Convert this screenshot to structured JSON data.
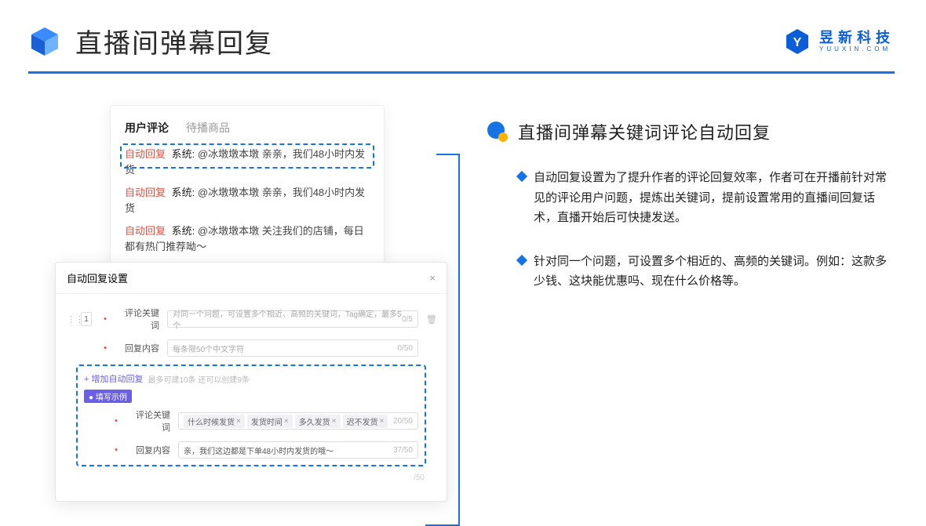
{
  "header": {
    "title": "直播间弹幕回复",
    "brand_cn": "昱新科技",
    "brand_en": "YUUXIN.COM"
  },
  "comments_card": {
    "tab_active": "用户评论",
    "tab_inactive": "待播商品",
    "auto_reply_label": "自动回复",
    "system_label": "系统:",
    "c1": "@冰墩墩本墩 亲亲，我们48小时内发货",
    "c2": "@冰墩墩本墩 亲亲，我们48小时内发货",
    "c3": "@冰墩墩本墩 关注我们的店铺，每日都有热门推荐呦～"
  },
  "settings": {
    "title": "自动回复设置",
    "rownum": "1",
    "kw_label": "评论关键词",
    "kw_placeholder": "对同一个问题，可设置多个相近、高频的关键词，Tag确定，最多5个",
    "kw_count": "0/5",
    "content_label": "回复内容",
    "content_placeholder": "每条限50个中文字符",
    "content_count": "0/50",
    "add_link": "+ 增加自动回复",
    "add_hint": "最多可建10条 还可以创建9条",
    "ex_badge": "● 填写示例",
    "ex_kw_label": "评论关键词",
    "chips": [
      "什么时候发货",
      "发货时间",
      "多久发货",
      "迟不发货"
    ],
    "ex_kw_count": "20/50",
    "ex_content_label": "回复内容",
    "ex_content_value": "亲，我们这边都是下单48小时内发货的哦～",
    "ex_content_count": "37/50",
    "trailing_count": "/50"
  },
  "right": {
    "title": "直播间弹幕关键词评论自动回复",
    "b1": "自动回复设置为了提升作者的评论回复效率，作者可在开播前针对常见的评论用户问题，提炼出关键词，提前设置常用的直播间回复话术，直播开始后可快捷发送。",
    "b2": "针对同一个问题，可设置多个相近的、高频的关键词。例如：这款多少钱、这块能优惠吗、现在什么价格等。"
  }
}
